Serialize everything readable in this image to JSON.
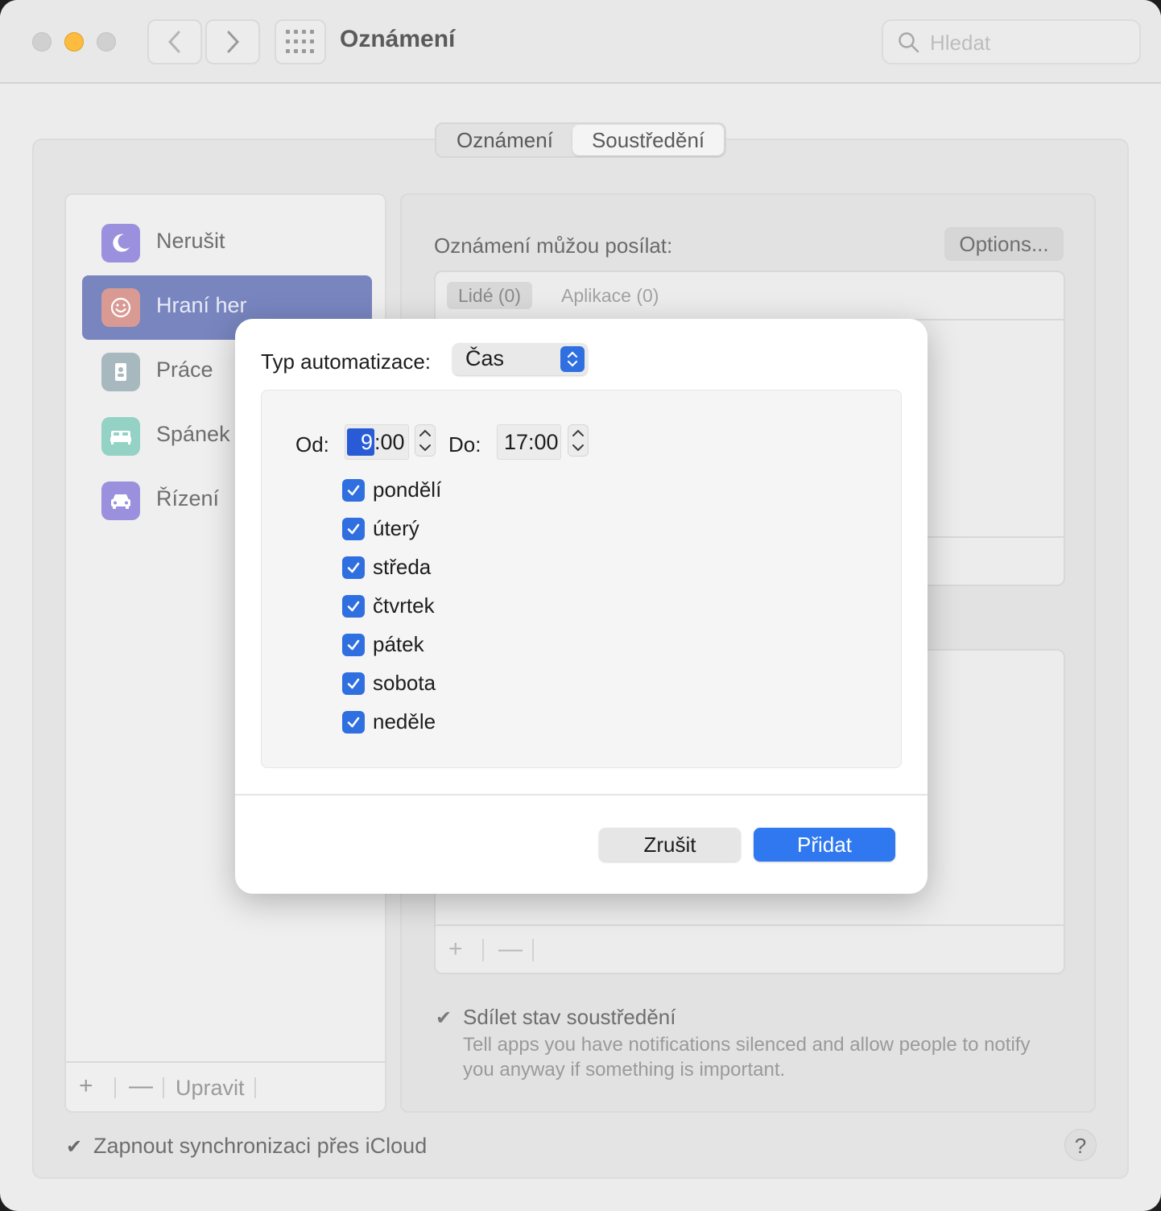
{
  "window": {
    "title": "Oznámení",
    "search_placeholder": "Hledat"
  },
  "segmented": {
    "tabs": [
      {
        "label": "Oznámení",
        "active": false
      },
      {
        "label": "Soustředění",
        "active": true
      }
    ]
  },
  "sidebar": {
    "items": [
      {
        "label": "Nerušit",
        "icon": "moon-icon",
        "color": "#7a6fd0"
      },
      {
        "label": "Hraní her",
        "icon": "smiley-icon",
        "color": "#e07c6c",
        "selected": true
      },
      {
        "label": "Práce",
        "icon": "id-badge-icon",
        "color": "#8fa8b0"
      },
      {
        "label": "Spánek",
        "icon": "bed-icon",
        "color": "#6fc2b0"
      },
      {
        "label": "Řízení",
        "icon": "car-icon",
        "color": "#7a6fd0"
      }
    ],
    "footer": {
      "add": "+",
      "remove": "—",
      "edit": "Upravit"
    }
  },
  "main": {
    "allowed_heading": "Oznámení můžou posílat:",
    "options_button": "Options...",
    "allowed_tabs": [
      {
        "label": "Lidé (0)",
        "active": true
      },
      {
        "label": "Aplikace (0)",
        "active": false
      }
    ],
    "schedule_footer": {
      "add": "+",
      "remove": "—"
    },
    "share": {
      "checked": true,
      "title": "Sdílet stav soustředění",
      "description": "Tell apps you have notifications silenced and allow people to notify you anyway if something is important."
    }
  },
  "icloud": {
    "checked": true,
    "label": "Zapnout synchronizaci přes iCloud"
  },
  "help_label": "?",
  "sheet": {
    "type_label": "Typ automatizace:",
    "type_value": "Čas",
    "from_label": "Od:",
    "from_hour": "9",
    "from_rest": ":00",
    "to_label": "Do:",
    "to_value": "17:00",
    "days": [
      {
        "label": "pondělí",
        "checked": true
      },
      {
        "label": "úterý",
        "checked": true
      },
      {
        "label": "středa",
        "checked": true
      },
      {
        "label": "čtvrtek",
        "checked": true
      },
      {
        "label": "pátek",
        "checked": true
      },
      {
        "label": "sobota",
        "checked": true
      },
      {
        "label": "neděle",
        "checked": true
      }
    ],
    "cancel_button": "Zrušit",
    "add_button": "Přidat"
  },
  "colors": {
    "accent": "#2f78f0",
    "selected_sidebar": "#7885bf"
  }
}
